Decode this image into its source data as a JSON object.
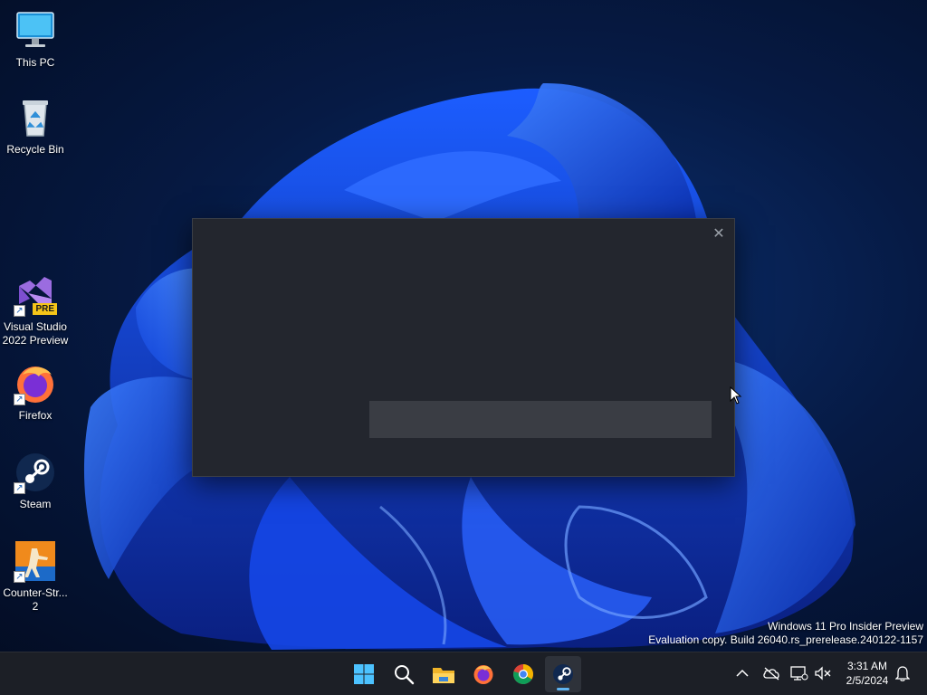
{
  "desktop": {
    "icons": [
      {
        "label": "This PC",
        "icon": "monitor-icon"
      },
      {
        "label": "Recycle Bin",
        "icon": "recycle-bin-icon"
      },
      {
        "label": "Visual Studio\n2022 Preview",
        "icon": "visual-studio-icon",
        "badge": "PRE"
      },
      {
        "label": "Firefox",
        "icon": "firefox-icon"
      },
      {
        "label": "Steam",
        "icon": "steam-icon"
      },
      {
        "label": "Counter-Str...\n2",
        "icon": "counter-strike-icon"
      }
    ]
  },
  "dialog": {
    "close_glyph": "✕",
    "progress_fraction": 0
  },
  "watermark": {
    "line1": "Windows 11 Pro Insider Preview",
    "line2": "Evaluation copy. Build 26040.rs_prerelease.240122-1157"
  },
  "taskbar": {
    "apps": [
      "start-icon",
      "search-icon",
      "file-explorer-icon",
      "firefox-icon",
      "chrome-icon",
      "steam-icon"
    ],
    "active_app": "steam-icon",
    "clock_time": "3:31 AM",
    "clock_date": "2/5/2024"
  },
  "colors": {
    "accent": "#5fb3f0",
    "dialog_bg": "#23262e",
    "taskbar_bg": "#1c1f26"
  }
}
